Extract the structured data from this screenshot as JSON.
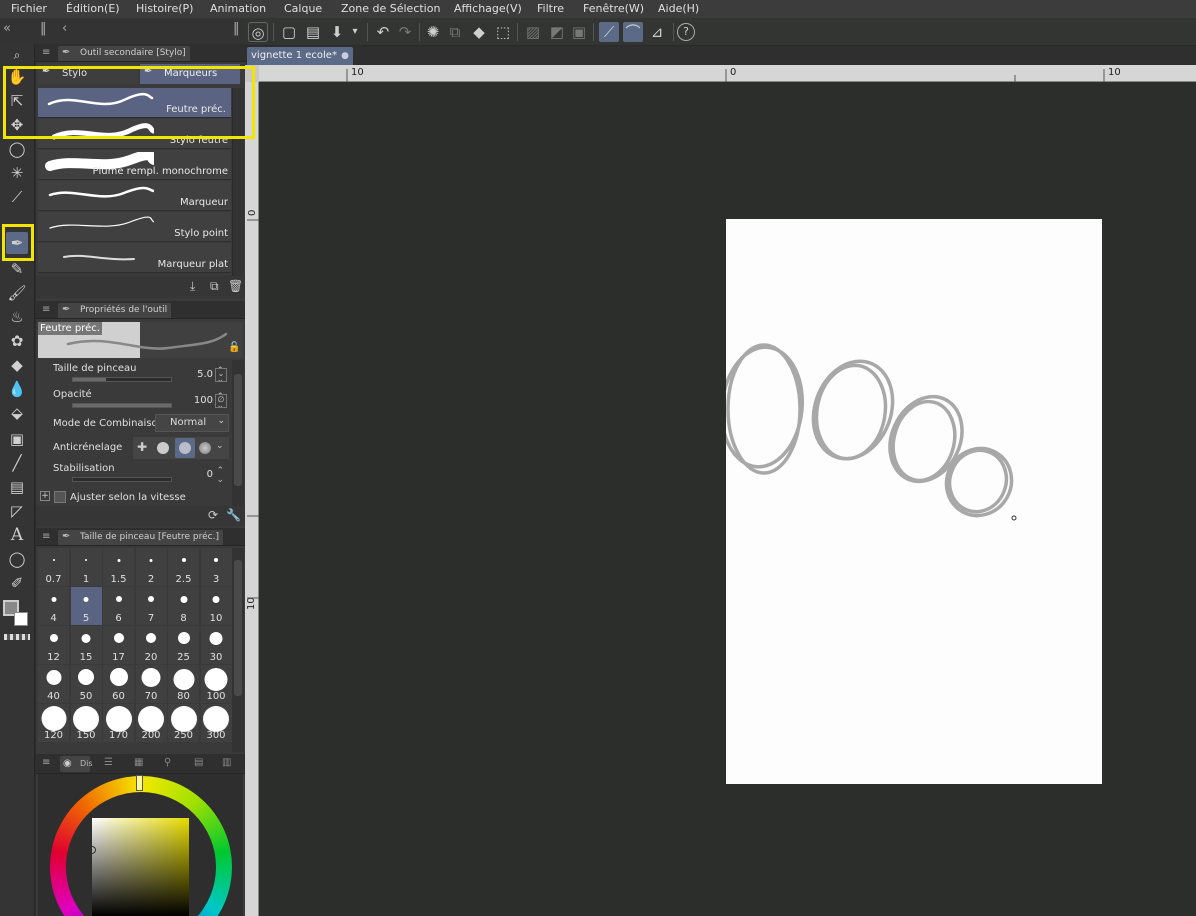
{
  "menu": [
    "Fichier",
    "Édition(E)",
    "Histoire(P)",
    "Animation",
    "Calque",
    "Zone de Sélection",
    "Affichage(V)",
    "Filtre",
    "Fenêtre(W)",
    "Aide(H)"
  ],
  "sub_tool_panel": {
    "title": "Outil secondaire [Stylo]",
    "tabs": [
      "Stylo",
      "Marqueurs"
    ],
    "active_tab": "Marqueurs",
    "brushes": [
      "Feutre préc.",
      "Stylo feutre",
      "Plume rempl. monochrome",
      "Marqueur",
      "Stylo point",
      "Marqueur plat"
    ],
    "selected_brush": "Feutre préc."
  },
  "tool_property": {
    "title": "Propriétés de l'outil",
    "preview_label": "Feutre préc.",
    "brush_size_label": "Taille de pinceau",
    "brush_size_value": "5.0",
    "opacity_label": "Opacité",
    "opacity_value": "100",
    "blend_mode_label": "Mode de Combinaison",
    "blend_mode_value": "Normal",
    "antialias_label": "Anticrénelage",
    "stabilization_label": "Stabilisation",
    "stabilization_value": "0",
    "speed_adjust_label": "Ajuster selon la vitesse"
  },
  "brush_size_panel": {
    "title": "Taille de pinceau [Feutre préc.]",
    "sizes": [
      "0.7",
      "1",
      "1.5",
      "2",
      "2.5",
      "3",
      "4",
      "5",
      "6",
      "7",
      "8",
      "10",
      "12",
      "15",
      "17",
      "20",
      "25",
      "30",
      "40",
      "50",
      "60",
      "70",
      "80",
      "100",
      "120",
      "150",
      "170",
      "200",
      "250",
      "300"
    ],
    "selected": "5"
  },
  "color_panel": {
    "tab_label": "Dis"
  },
  "document": {
    "tab_label": "vignette 1 ecole*"
  },
  "ruler": {
    "h_labels": [
      "10",
      "0",
      "10"
    ],
    "v_labels": [
      "0",
      "10"
    ]
  },
  "colors": {
    "accent": "#5b6a86",
    "highlight": "#f2e600",
    "paper": "#fdfdfd",
    "stroke": "#a8a8a8"
  }
}
